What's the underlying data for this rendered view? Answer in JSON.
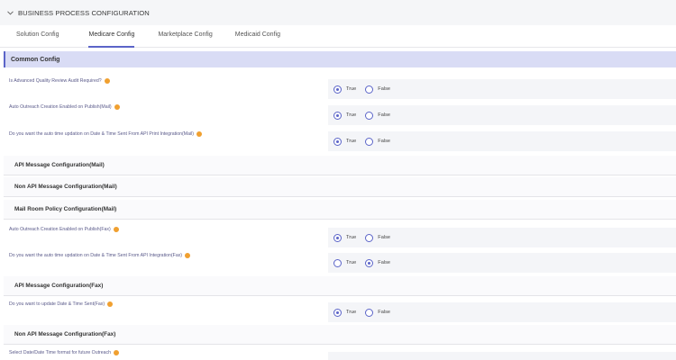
{
  "header": {
    "title": "BUSINESS PROCESS CONFIGURATION",
    "icon": "chevron-down-icon"
  },
  "tabs": [
    {
      "label": "Solution Config",
      "active": false
    },
    {
      "label": "Medicare Config",
      "active": true
    },
    {
      "label": "Marketplace Config",
      "active": false
    },
    {
      "label": "Medicaid Config",
      "active": false
    }
  ],
  "section": {
    "title": "Common Config"
  },
  "options": {
    "true_label": "True",
    "false_label": "False"
  },
  "questions": [
    {
      "label": "Is Advanced Quality Review Audit Required?",
      "selected": "True"
    },
    {
      "label": "Auto Outreach Creation Enabled on Publish(Mail)",
      "selected": "True"
    },
    {
      "label": "Do you want the auto time updation on Date & Time Sent From API Print Integration(Mail)",
      "selected": "True"
    },
    {
      "label": "Auto Outreach Creation Enabled on Publish(Fax)",
      "selected": "True"
    },
    {
      "label": "Do you want the auto time updation on Date & Time Sent From API Integration(Fax)",
      "selected": "False"
    },
    {
      "label": "Do you want to update Date & Time Sent(Fax)",
      "selected": "True"
    },
    {
      "label": "Select Date/Date Time format for future Outreach",
      "selected": ""
    }
  ],
  "groups": [
    {
      "label": "API Message Configuration(Mail)"
    },
    {
      "label": "Non API Message Configuration(Mail)"
    },
    {
      "label": "Mail Room Policy Configuration(Mail)"
    },
    {
      "label": "API Message Configuration(Fax)"
    },
    {
      "label": "Non API Message Configuration(Fax)"
    }
  ],
  "colors": {
    "accent": "#5b64c8",
    "info": "#f0a030",
    "section_bg": "#d9dcf5"
  }
}
